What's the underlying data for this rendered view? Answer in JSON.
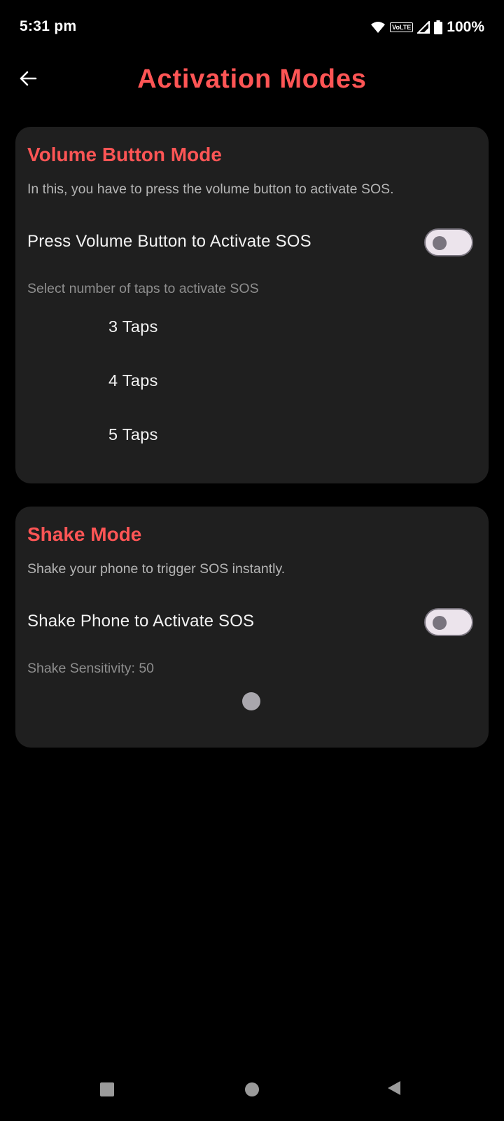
{
  "status_bar": {
    "time": "5:31 pm",
    "battery": "100%",
    "icons": [
      "wifi-icon",
      "volte-icon",
      "signal-icon",
      "battery-icon"
    ],
    "volte_label": "VoLTE"
  },
  "app_bar": {
    "title": "Activation Modes",
    "back_icon": "arrow-left-icon"
  },
  "volume_card": {
    "title": "Volume Button Mode",
    "description": "In this, you have to press the volume button to activate SOS.",
    "toggle_label": "Press Volume Button to Activate SOS",
    "toggle_on": false,
    "taps_label": "Select number of taps to activate SOS",
    "tap_options": [
      "3 Taps",
      "4 Taps",
      "5 Taps"
    ]
  },
  "shake_card": {
    "title": "Shake Mode",
    "description": "Shake your phone to trigger SOS instantly.",
    "toggle_label": "Shake Phone to Activate SOS",
    "toggle_on": false,
    "sensitivity_label": "Shake Sensitivity: 50"
  },
  "nav_bar": {
    "buttons": [
      "recents-icon",
      "home-icon",
      "back-icon"
    ]
  },
  "colors": {
    "accent": "#ff5555",
    "card_bg": "#1f1f1f",
    "background": "#000000"
  }
}
